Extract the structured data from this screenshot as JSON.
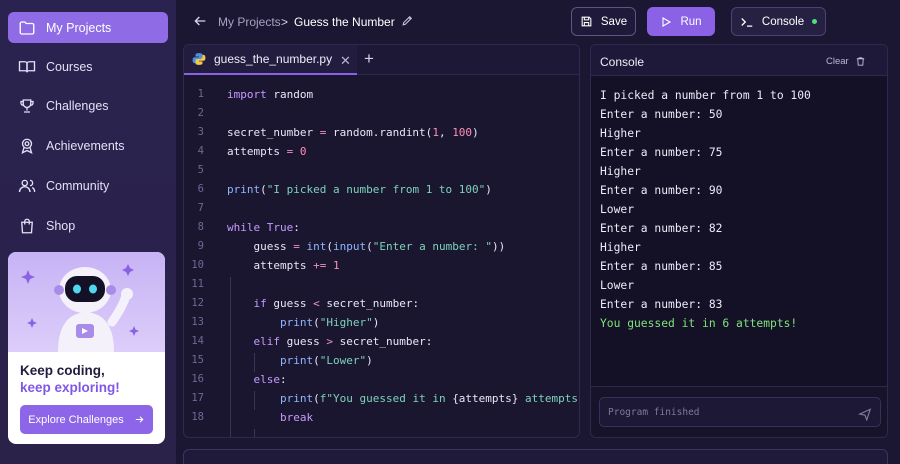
{
  "sidebar": {
    "items": [
      {
        "label": "My Projects",
        "icon": "folder-icon",
        "active": true
      },
      {
        "label": "Courses",
        "icon": "book-icon"
      },
      {
        "label": "Challenges",
        "icon": "trophy-icon"
      },
      {
        "label": "Achievements",
        "icon": "medal-icon"
      },
      {
        "label": "Community",
        "icon": "users-icon"
      },
      {
        "label": "Shop",
        "icon": "shopping-bag-icon"
      }
    ],
    "promo": {
      "title": "Keep coding,",
      "title_accent": "keep exploring!",
      "button": "Explore Challenges"
    }
  },
  "header": {
    "breadcrumb_parent": "My Projects",
    "breadcrumb_separator": ">",
    "breadcrumb_current": "Guess the Number",
    "save_label": "Save",
    "run_label": "Run",
    "console_label": "Console"
  },
  "editor": {
    "tab_name": "guess_the_number.py",
    "line_numbers": [
      "1",
      "2",
      "3",
      "4",
      "5",
      "6",
      "7",
      "8",
      "9",
      "10",
      "11",
      "12",
      "13",
      "14",
      "15",
      "16",
      "17",
      "18"
    ]
  },
  "console": {
    "title": "Console",
    "clear_label": "Clear",
    "output": [
      "I picked a number from 1 to 100",
      "Enter a number: 50",
      "Higher",
      "Enter a number: 75",
      "Higher",
      "Enter a number: 90",
      "Lower",
      "Enter a number: 82",
      "Higher",
      "Enter a number: 85",
      "Lower",
      "Enter a number: 83"
    ],
    "result": "You guessed it in 6 attempts!",
    "input_placeholder": "Program finished"
  },
  "colors": {
    "accent": "#8b62e6",
    "success": "#7fe37a",
    "status_dot": "#4ee07a"
  }
}
